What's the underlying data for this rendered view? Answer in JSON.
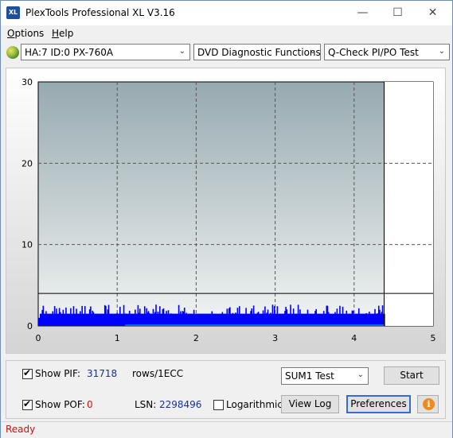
{
  "window": {
    "title": "PlexTools Professional XL V3.16",
    "icon_text": "XL",
    "controls": [
      "minimize-icon",
      "maximize-icon",
      "close-icon"
    ]
  },
  "menu": {
    "items": [
      {
        "label": "Options",
        "mnemonic": "O"
      },
      {
        "label": "Help",
        "mnemonic": "H"
      }
    ]
  },
  "toolbar": {
    "drive": "HA:7 ID:0  PX-760A",
    "function": "DVD Diagnostic Functions",
    "test": "Q-Check PI/PO Test"
  },
  "chart_data": {
    "type": "bar",
    "x_ticks": [
      "0",
      "1",
      "2",
      "3",
      "4",
      "5"
    ],
    "y_ticks": [
      "0",
      "10",
      "20",
      "30"
    ],
    "xlim": [
      0,
      5
    ],
    "ylim": [
      0,
      30
    ],
    "grid": true,
    "threshold": 4,
    "test_end": 4.38,
    "series": [
      {
        "color": "#0000ff",
        "base_level": 1.5,
        "max": 5
      }
    ],
    "colors": {
      "plot_bg_top": "#97aab0",
      "plot_bg_bottom": "#f2f4f4",
      "bar": "#0000ff",
      "baseline": "#00c8ff"
    }
  },
  "controls": {
    "show_pif_label": "Show PIF:",
    "pif_value": "31718",
    "pif_unit": "rows/1ECC",
    "show_pof_label": "Show POF:",
    "pof_value": "0",
    "lsn_label": "LSN:",
    "lsn_value": "2298496",
    "logarithmic_label": "Logarithmic",
    "sum_select": "SUM1 Test",
    "start_button": "Start",
    "viewlog_button": "View Log",
    "preferences_button": "Preferences",
    "pif_checked": true,
    "pof_checked": true,
    "log_checked": false
  },
  "status": {
    "text": "Ready"
  }
}
